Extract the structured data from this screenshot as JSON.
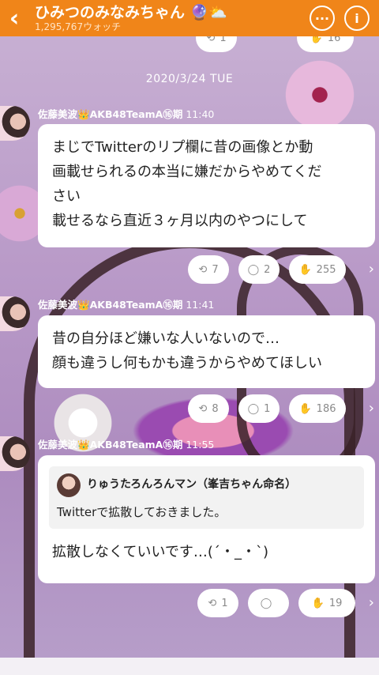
{
  "header": {
    "title": "ひみつのみなみちゃん",
    "title_emoji": "🔮⛅",
    "watch_count": "1,295,767ウォッチ"
  },
  "date_separator": "2020/3/24 TUE",
  "posts": [
    {
      "author": "佐藤美波",
      "crown": "👑",
      "group": "AKB48TeamA⑯期",
      "time": "11:40",
      "lines": [
        "まじでTwitterのリプ欄に昔の画像とか動",
        "画載せられるの本当に嫌だからやめてくだ",
        "さい",
        "載せるなら直近３ヶ月以内のやつにして"
      ],
      "retweets": "7",
      "comments": "2",
      "claps": "255"
    },
    {
      "author": "佐藤美波",
      "crown": "👑",
      "group": "AKB48TeamA⑯期",
      "time": "11:41",
      "lines": [
        "昔の自分ほど嫌いな人いないので…",
        "顔も違うし何もかも違うからやめてほしい"
      ],
      "retweets": "8",
      "comments": "1",
      "claps": "186"
    },
    {
      "author": "佐藤美波",
      "crown": "👑",
      "group": "AKB48TeamA⑯期",
      "time": "11:55",
      "quote": {
        "name": "りゅうたろんろんマン（峯吉ちゃん命名）",
        "text": "Twitterで拡散しておきました。"
      },
      "lines": [
        "拡散しなくていいです…(´・_・`)"
      ],
      "retweets": "1",
      "comments": "",
      "claps": "19"
    }
  ],
  "top_partial": {
    "retweets": "1",
    "claps": "16"
  },
  "colors": {
    "header": "#f08519",
    "text_muted": "#8a8a8a"
  }
}
